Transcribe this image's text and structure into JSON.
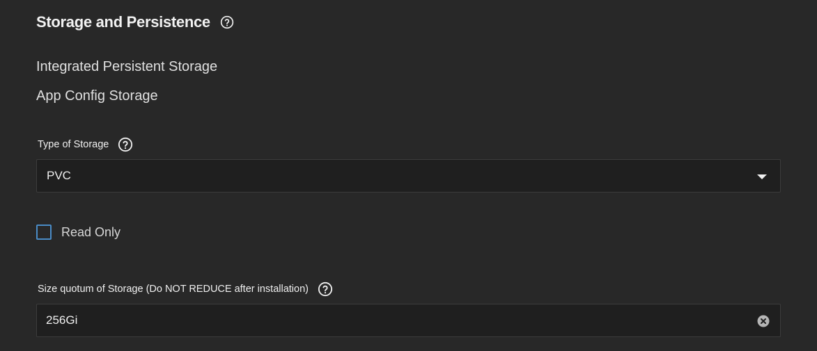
{
  "section": {
    "title": "Storage and Persistence",
    "help_icon": "help-circle-icon"
  },
  "subheadings": {
    "integrated": "Integrated Persistent Storage",
    "app_config": "App Config Storage"
  },
  "storage_type": {
    "label": "Type of Storage",
    "help_icon": "help-circle-icon",
    "selected_value": "PVC",
    "dropdown_icon": "caret-down-icon"
  },
  "read_only": {
    "label": "Read Only",
    "checked": false,
    "accent_color": "#4a8cc7"
  },
  "size_quota": {
    "label": "Size quotum of Storage (Do NOT REDUCE after installation)",
    "help_icon": "help-circle-icon",
    "value": "256Gi",
    "clear_icon": "clear-circle-icon"
  },
  "colors": {
    "background": "#282828",
    "field_background": "#1f1f1f",
    "text": "#f0f0f0"
  }
}
